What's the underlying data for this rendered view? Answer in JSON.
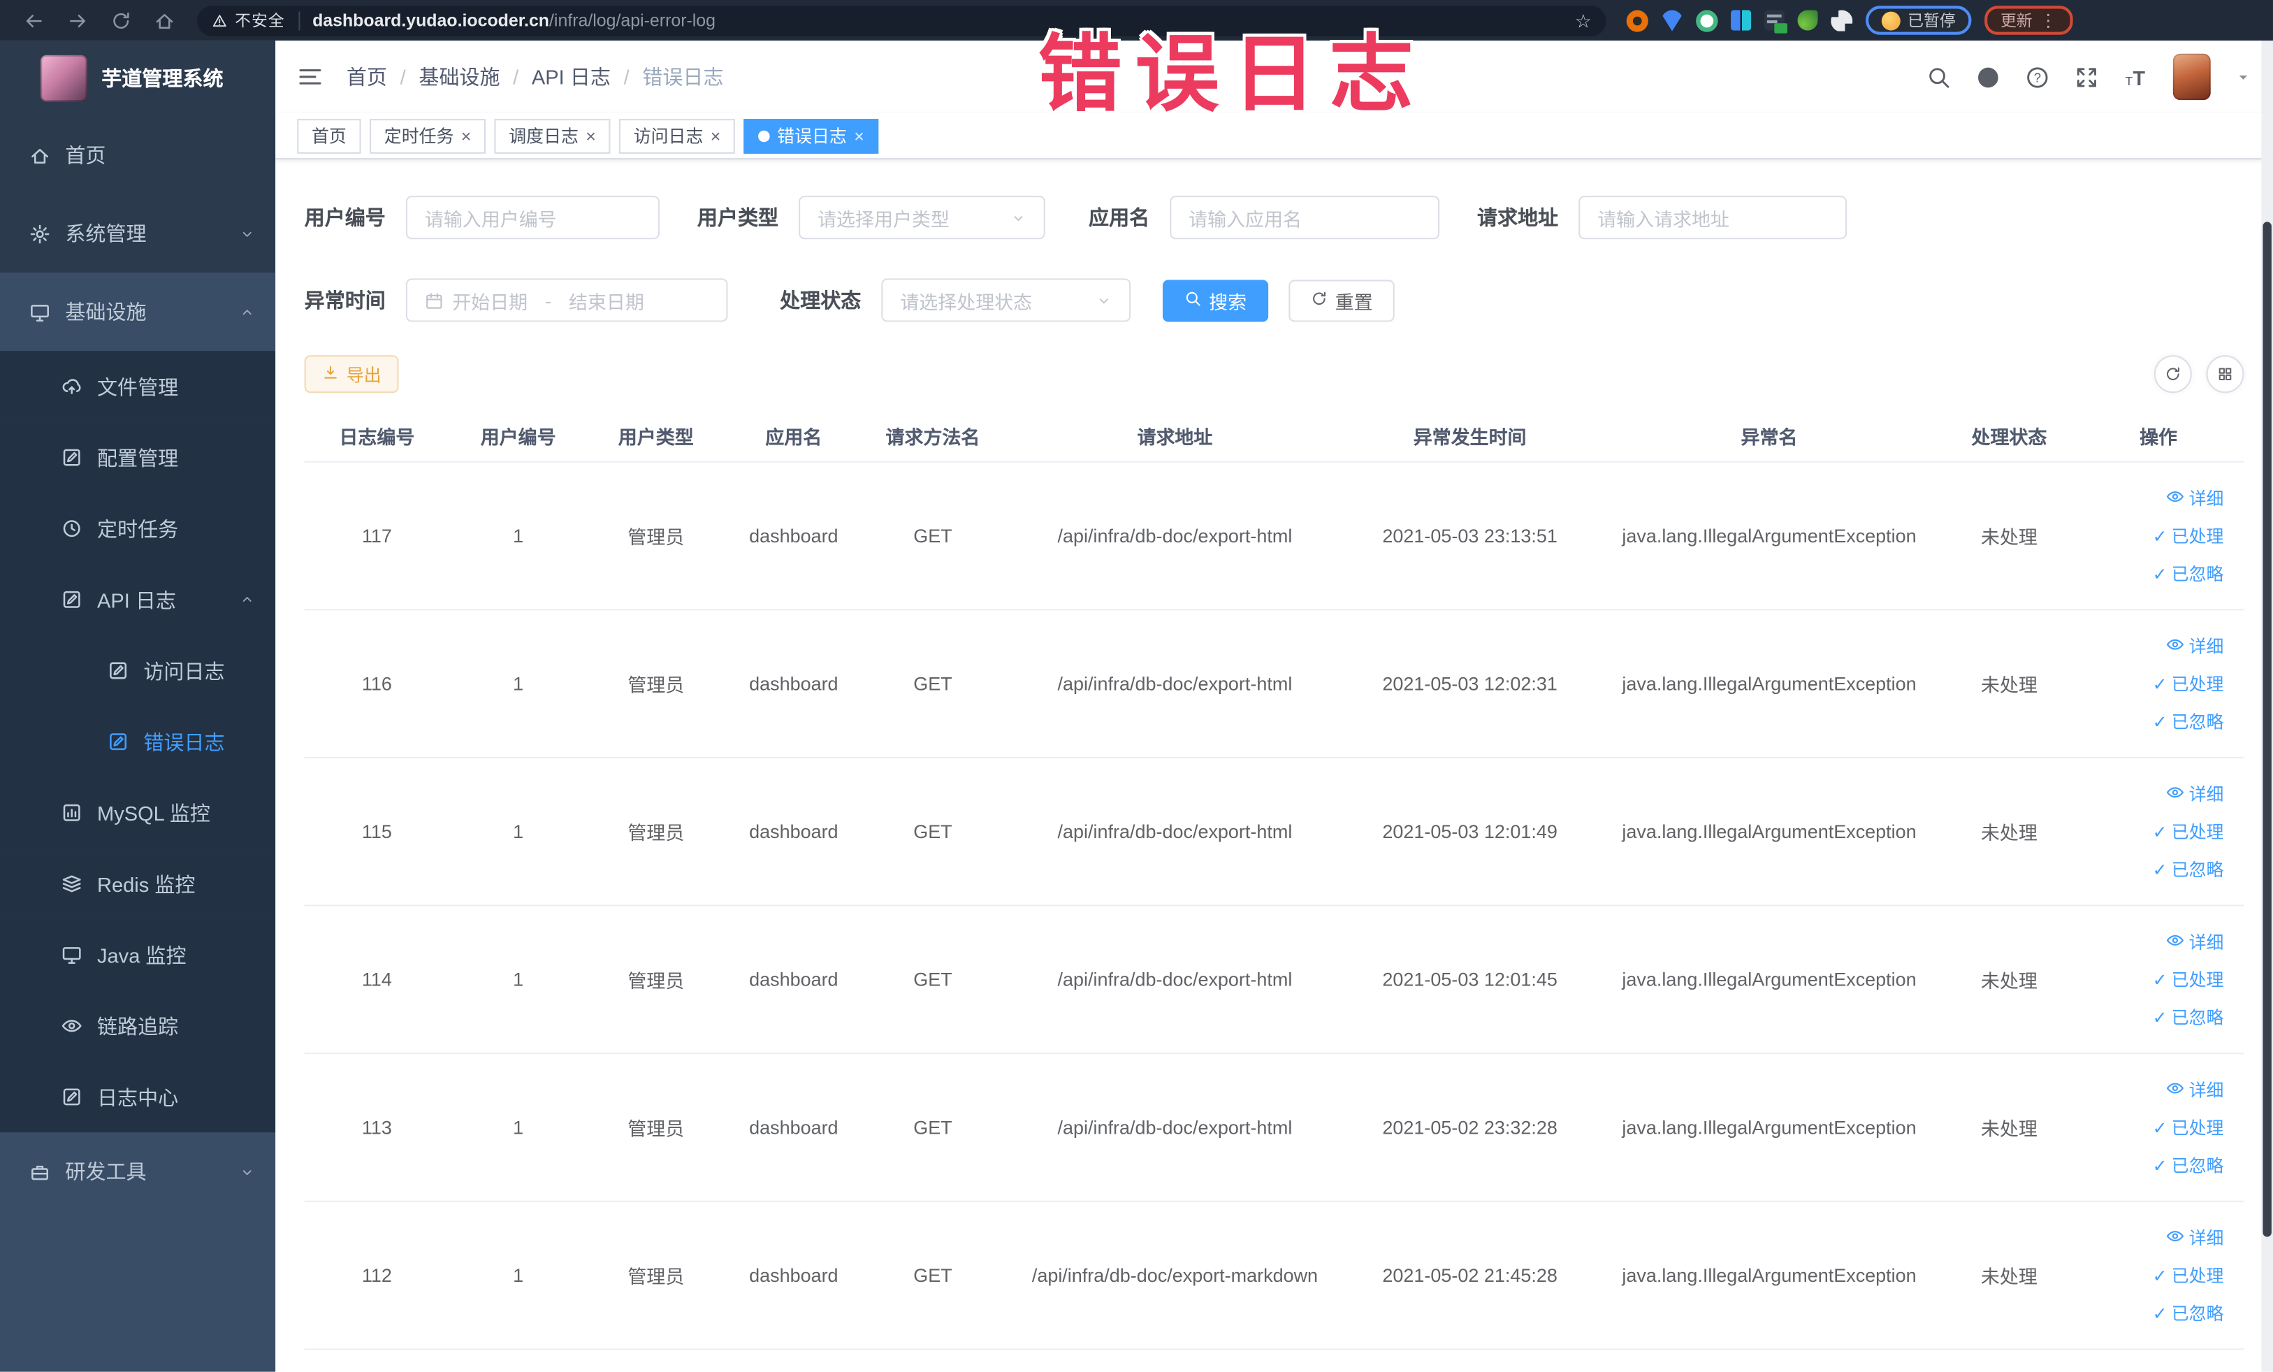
{
  "browser": {
    "security_label": "不安全",
    "url_domain": "dashboard.yudao.iocoder.cn",
    "url_path": "/infra/log/api-error-log",
    "paused_badge": "已暂停",
    "update_badge": "更新",
    "menu_glyph": "⋮",
    "star_glyph": "☆"
  },
  "watermark": "错误日志",
  "sidebar": {
    "title": "芋道管理系统",
    "items": [
      {
        "label": "首页",
        "icon": "home",
        "depth": 0
      },
      {
        "label": "系统管理",
        "icon": "gear",
        "depth": 0,
        "chevron": "down"
      },
      {
        "label": "基础设施",
        "icon": "monitor",
        "depth": 0,
        "chevron": "up",
        "highlight": true
      },
      {
        "label": "文件管理",
        "icon": "cloud",
        "depth": 1
      },
      {
        "label": "配置管理",
        "icon": "edit",
        "depth": 1
      },
      {
        "label": "定时任务",
        "icon": "history",
        "depth": 1
      },
      {
        "label": "API 日志",
        "icon": "log",
        "depth": 1,
        "chevron": "up"
      },
      {
        "label": "访问日志",
        "icon": "log",
        "depth": 2
      },
      {
        "label": "错误日志",
        "icon": "log",
        "depth": 2,
        "active": true
      },
      {
        "label": "MySQL 监控",
        "icon": "chart",
        "depth": 1
      },
      {
        "label": "Redis 监控",
        "icon": "layers",
        "depth": 1
      },
      {
        "label": "Java 监控",
        "icon": "monitor",
        "depth": 1
      },
      {
        "label": "链路追踪",
        "icon": "eye",
        "depth": 1
      },
      {
        "label": "日志中心",
        "icon": "log",
        "depth": 1
      },
      {
        "label": "研发工具",
        "icon": "tool",
        "depth": 0,
        "chevron": "down",
        "highlight": true
      }
    ]
  },
  "header": {
    "breadcrumb": [
      "首页",
      "基础设施",
      "API 日志",
      "错误日志"
    ],
    "separator": "/"
  },
  "tabs": [
    {
      "label": "首页",
      "closable": false,
      "active": false
    },
    {
      "label": "定时任务",
      "closable": true,
      "active": false
    },
    {
      "label": "调度日志",
      "closable": true,
      "active": false
    },
    {
      "label": "访问日志",
      "closable": true,
      "active": false
    },
    {
      "label": "错误日志",
      "closable": true,
      "active": true
    }
  ],
  "filters": {
    "user_id": {
      "label": "用户编号",
      "placeholder": "请输入用户编号"
    },
    "user_type": {
      "label": "用户类型",
      "placeholder": "请选择用户类型"
    },
    "app_name": {
      "label": "应用名",
      "placeholder": "请输入应用名"
    },
    "request_url": {
      "label": "请求地址",
      "placeholder": "请输入请求地址"
    },
    "exception_time": {
      "label": "异常时间",
      "start_placeholder": "开始日期",
      "separator": "-",
      "end_placeholder": "结束日期"
    },
    "process_status": {
      "label": "处理状态",
      "placeholder": "请选择处理状态"
    },
    "search_label": "搜索",
    "reset_label": "重置"
  },
  "toolbar": {
    "export_label": "导出"
  },
  "table": {
    "columns": [
      "日志编号",
      "用户编号",
      "用户类型",
      "应用名",
      "请求方法名",
      "请求地址",
      "异常发生时间",
      "异常名",
      "处理状态",
      "操作"
    ],
    "actions": [
      "详细",
      "已处理",
      "已忽略"
    ],
    "rows": [
      {
        "cells": [
          "117",
          "1",
          "管理员",
          "dashboard",
          "GET",
          "/api/infra/db-doc/export-html",
          "2021-05-03 23:13:51",
          "java.lang.IllegalArgumentException",
          "未处理"
        ]
      },
      {
        "cells": [
          "116",
          "1",
          "管理员",
          "dashboard",
          "GET",
          "/api/infra/db-doc/export-html",
          "2021-05-03 12:02:31",
          "java.lang.IllegalArgumentException",
          "未处理"
        ]
      },
      {
        "cells": [
          "115",
          "1",
          "管理员",
          "dashboard",
          "GET",
          "/api/infra/db-doc/export-html",
          "2021-05-03 12:01:49",
          "java.lang.IllegalArgumentException",
          "未处理"
        ]
      },
      {
        "cells": [
          "114",
          "1",
          "管理员",
          "dashboard",
          "GET",
          "/api/infra/db-doc/export-html",
          "2021-05-03 12:01:45",
          "java.lang.IllegalArgumentException",
          "未处理"
        ]
      },
      {
        "cells": [
          "113",
          "1",
          "管理员",
          "dashboard",
          "GET",
          "/api/infra/db-doc/export-html",
          "2021-05-02 23:32:28",
          "java.lang.IllegalArgumentException",
          "未处理"
        ]
      },
      {
        "cells": [
          "112",
          "1",
          "管理员",
          "dashboard",
          "GET",
          "/api/infra/db-doc/export-markdown",
          "2021-05-02 21:45:28",
          "java.lang.IllegalArgumentException",
          "未处理"
        ]
      }
    ]
  },
  "ui": {
    "close_glyph": "×",
    "check_glyph": "✓",
    "colors": {
      "accent": "#409eff",
      "warning": "#e6a23c",
      "watermark": "#ec3b5e",
      "sidebar_bg": "#2c3a4e",
      "submenu_bg": "#233144",
      "highlight_bg": "#3a4d66",
      "active_link": "#409eff"
    }
  }
}
